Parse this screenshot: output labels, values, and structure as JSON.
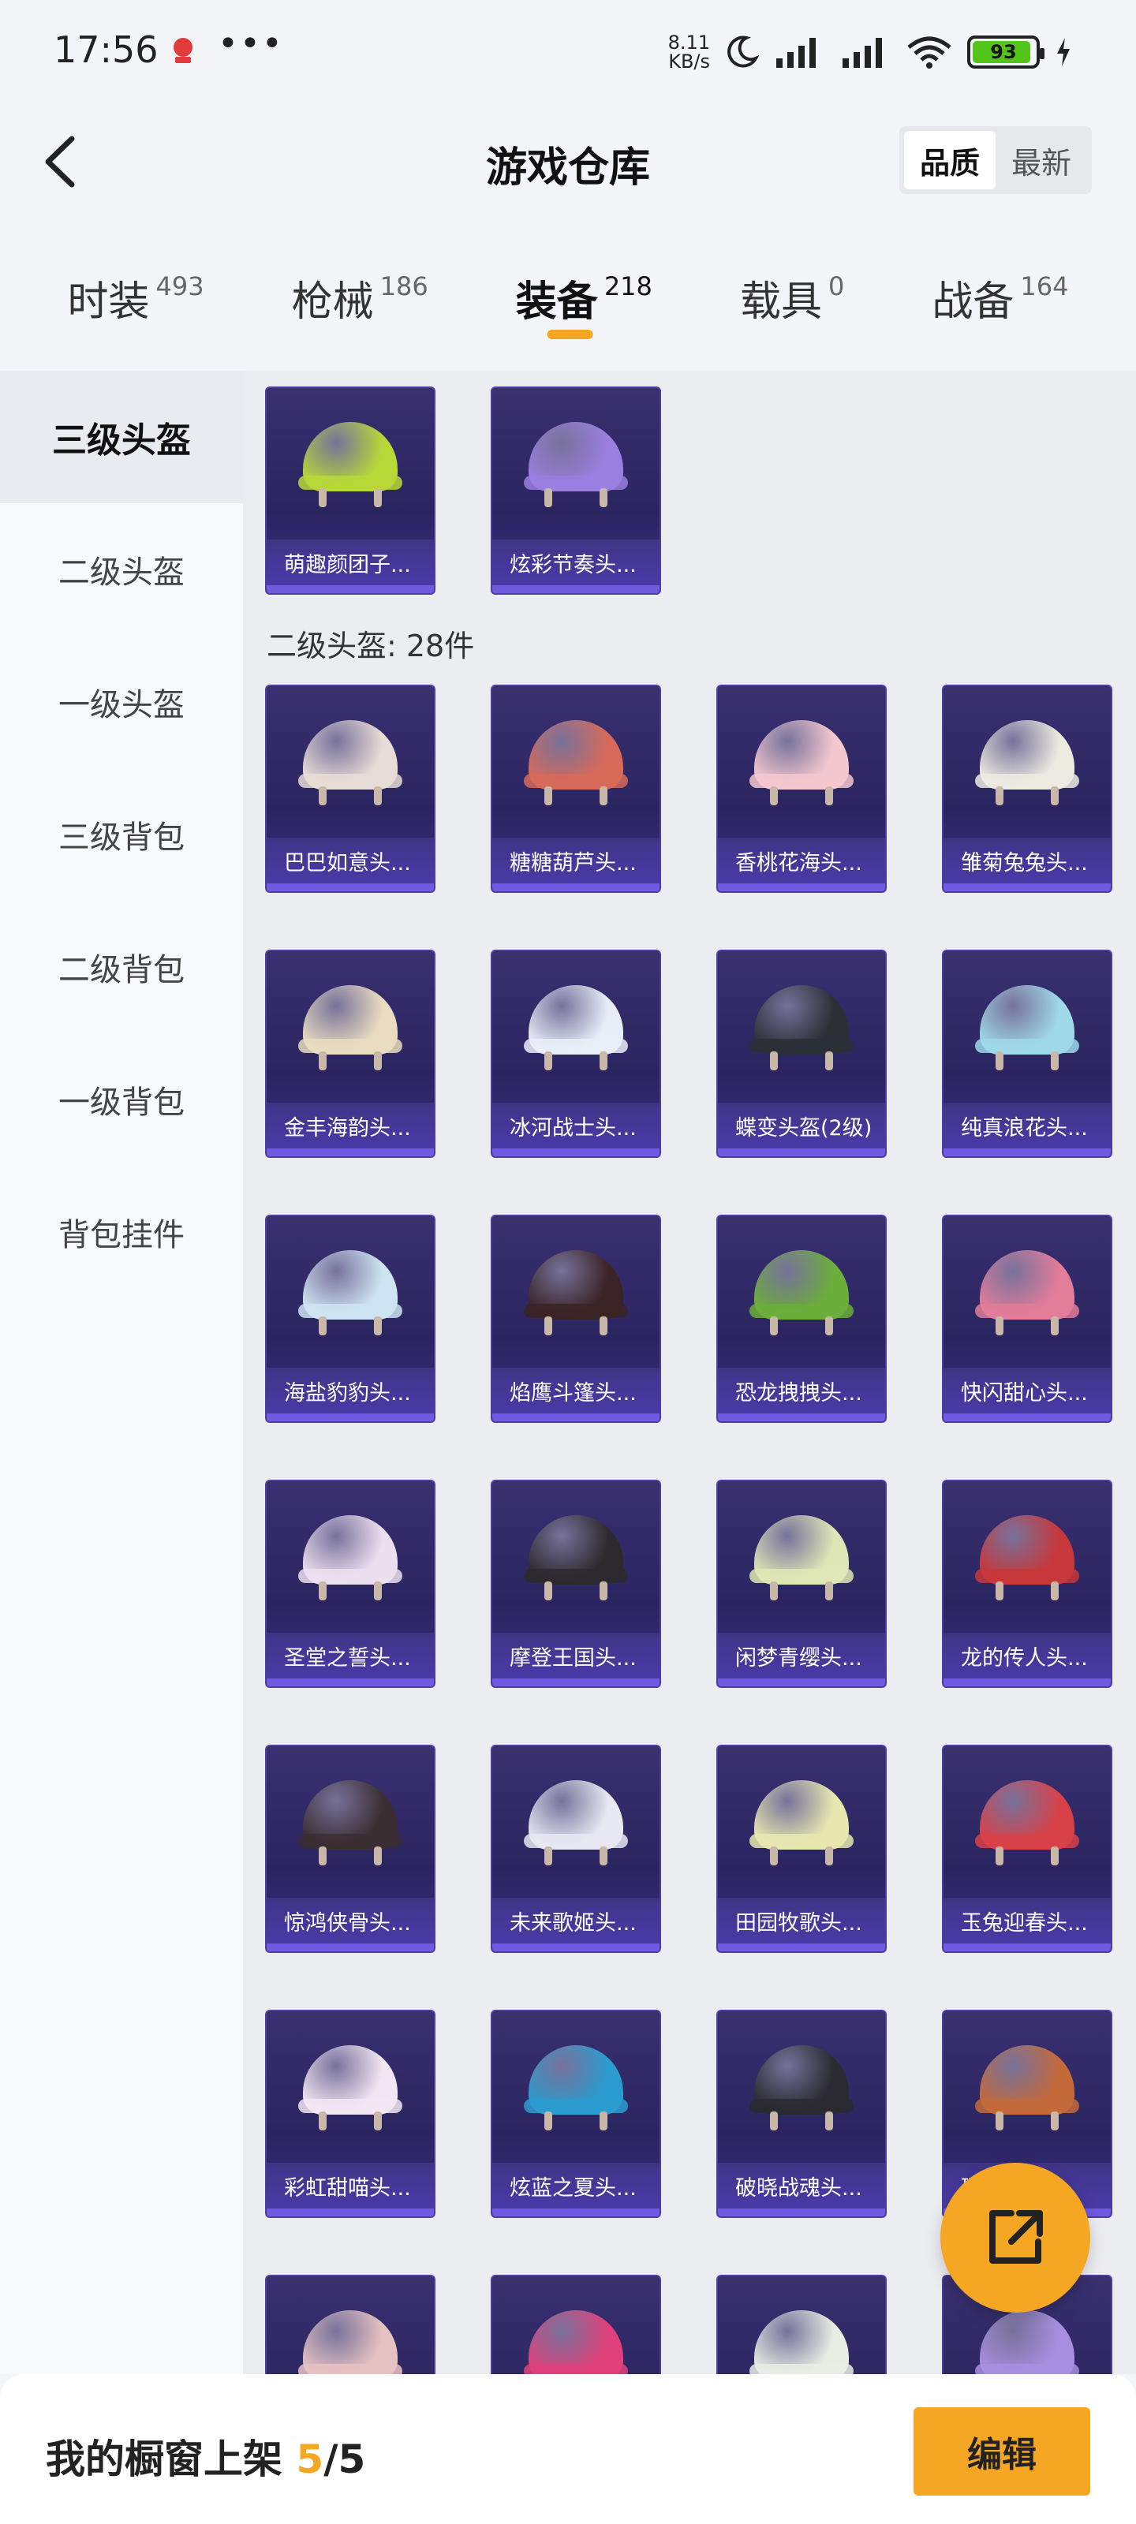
{
  "status": {
    "time": "17:56",
    "more": "•••",
    "speed_value": "8.11",
    "speed_unit": "KB/s",
    "battery": "93",
    "battery_level": 0.93
  },
  "header": {
    "title": "游戏仓库",
    "sort_options": [
      "品质",
      "最新"
    ],
    "sort_active": "品质"
  },
  "tabs": [
    {
      "label": "时装",
      "count": "493"
    },
    {
      "label": "枪械",
      "count": "186"
    },
    {
      "label": "装备",
      "count": "218"
    },
    {
      "label": "载具",
      "count": "0"
    },
    {
      "label": "战备",
      "count": "164"
    }
  ],
  "sidebar": {
    "items": [
      "三级头盔",
      "二级头盔",
      "一级头盔",
      "三级背包",
      "二级背包",
      "一级背包",
      "背包挂件"
    ],
    "active": "三级头盔"
  },
  "section_lvl3": {
    "items": [
      {
        "name": "萌趣颜团子...",
        "color": "#b8d838"
      },
      {
        "name": "炫彩节奏头...",
        "color": "#9b7fe0"
      }
    ]
  },
  "section_lvl2": {
    "title": "二级头盔: 28件",
    "items": [
      {
        "name": "巴巴如意头...",
        "color": "#e8ddd6"
      },
      {
        "name": "糖糖葫芦头...",
        "color": "#d86a5a"
      },
      {
        "name": "香桃花海头...",
        "color": "#f4c8cf"
      },
      {
        "name": "雏菊兔兔头...",
        "color": "#ecebe0"
      },
      {
        "name": "金丰海韵头...",
        "color": "#e9dcc0"
      },
      {
        "name": "冰河战士头...",
        "color": "#e8eef8"
      },
      {
        "name": "蝶变头盔(2级)",
        "color": "#2c2f36"
      },
      {
        "name": "纯真浪花头...",
        "color": "#9fd8e8"
      },
      {
        "name": "海盐豹豹头...",
        "color": "#cfe4f2"
      },
      {
        "name": "焰鹰斗篷头...",
        "color": "#3a2326"
      },
      {
        "name": "恐龙拽拽头...",
        "color": "#6cae3a"
      },
      {
        "name": "快闪甜心头...",
        "color": "#e27d9a"
      },
      {
        "name": "圣堂之誓头...",
        "color": "#ecdff0"
      },
      {
        "name": "摩登王国头...",
        "color": "#2d2a2e"
      },
      {
        "name": "闲梦青缨头...",
        "color": "#dfe6b6"
      },
      {
        "name": "龙的传人头...",
        "color": "#c8373a"
      },
      {
        "name": "惊鸿侠骨头...",
        "color": "#3b2e33"
      },
      {
        "name": "未来歌姬头...",
        "color": "#e6e8f2"
      },
      {
        "name": "田园牧歌头...",
        "color": "#e6e8b0"
      },
      {
        "name": "玉兔迎春头...",
        "color": "#d94148"
      },
      {
        "name": "彩虹甜喵头...",
        "color": "#f2e6f2"
      },
      {
        "name": "炫蓝之夏头...",
        "color": "#2b9ccf"
      },
      {
        "name": "破晓战魂头...",
        "color": "#2a2a30"
      },
      {
        "name": "瑞...",
        "color": "#c46a3a"
      },
      {
        "name": "",
        "color": "#e6c2c2"
      },
      {
        "name": "",
        "color": "#e0417a"
      },
      {
        "name": "",
        "color": "#e8ede4"
      },
      {
        "name": "",
        "color": "#a88fe0"
      }
    ]
  },
  "bottom": {
    "label_prefix": "我的橱窗上架",
    "count": "5",
    "total": "/5",
    "edit": "编辑"
  },
  "colors": {
    "accent": "#f5a623",
    "card_bg": "#2a2560",
    "card_label_bg": "#4a3aa8"
  }
}
